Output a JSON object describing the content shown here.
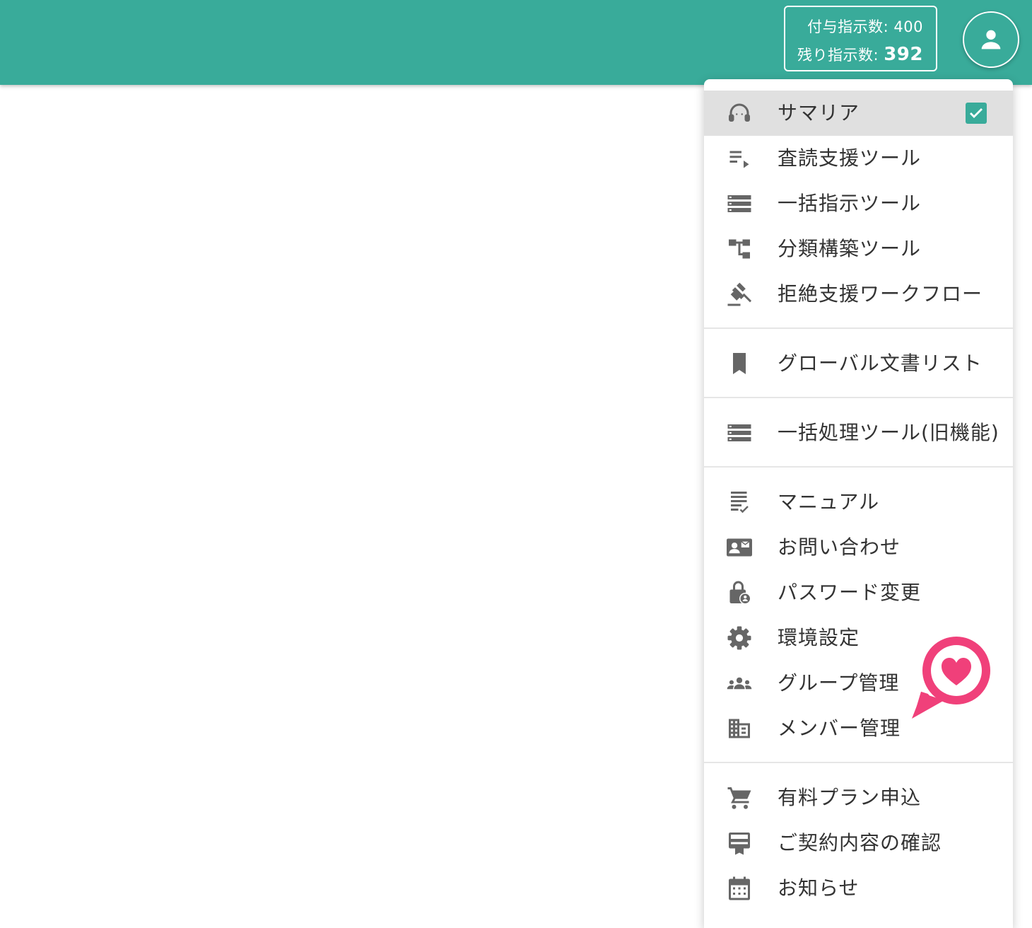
{
  "header": {
    "granted_label": "付与指示数:",
    "granted_value": "400",
    "remaining_label": "残り指示数:",
    "remaining_value": "392",
    "avatar_icon": "account-icon",
    "bar_color": "#39ab9a"
  },
  "menu": {
    "selected_item": "サマリア",
    "accent_color": "#39ab9a",
    "groups": [
      {
        "items": [
          {
            "label": "サマリア",
            "icon": "headset-icon",
            "selected": true
          },
          {
            "label": "査読支援ツール",
            "icon": "playlist-play-icon"
          },
          {
            "label": "一括指示ツール",
            "icon": "storage-list-icon"
          },
          {
            "label": "分類構築ツール",
            "icon": "account-tree-icon"
          },
          {
            "label": "拒絶支援ワークフロー",
            "icon": "gavel-icon"
          }
        ]
      },
      {
        "items": [
          {
            "label": "グローバル文書リスト",
            "icon": "bookmark-icon"
          }
        ]
      },
      {
        "items": [
          {
            "label": "一括処理ツール(旧機能)",
            "icon": "storage-list-icon"
          }
        ]
      },
      {
        "items": [
          {
            "label": "マニュアル",
            "icon": "manual-checklist-icon"
          },
          {
            "label": "お問い合わせ",
            "icon": "contact-mail-icon"
          },
          {
            "label": "パスワード変更",
            "icon": "lock-person-icon"
          },
          {
            "label": "環境設定",
            "icon": "gear-icon"
          },
          {
            "label": "グループ管理",
            "icon": "groups-icon"
          },
          {
            "label": "メンバー管理",
            "icon": "domain-icon"
          }
        ]
      },
      {
        "items": [
          {
            "label": "有料プラン申込",
            "icon": "cart-icon"
          },
          {
            "label": "ご契約内容の確認",
            "icon": "card-membership-icon"
          },
          {
            "label": "お知らせ",
            "icon": "calendar-icon"
          }
        ]
      }
    ]
  },
  "floating_badge": {
    "icon": "heart-icon",
    "color": "#f0407a"
  }
}
